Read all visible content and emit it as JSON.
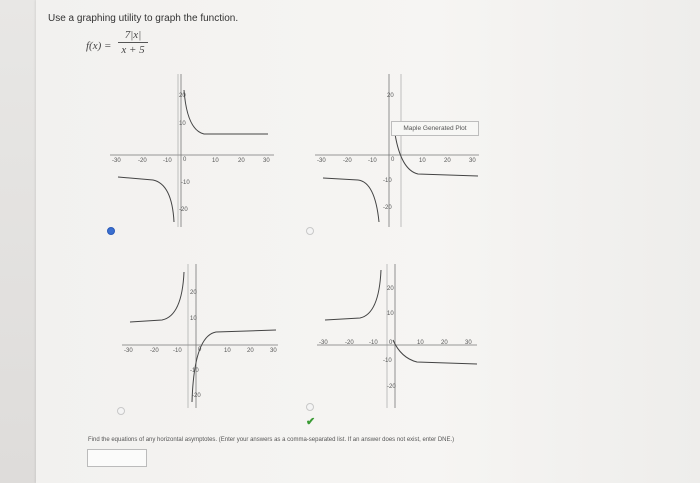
{
  "prompt": "Use a graphing utility to graph the function.",
  "function": {
    "label": "f(x) =",
    "numerator": "7|x|",
    "denominator": "x + 5"
  },
  "options": [
    {
      "id": "A",
      "selected": true,
      "x_ticks": [
        "-30",
        "-20",
        "-10",
        "0",
        "10",
        "20",
        "30"
      ],
      "y_ticks": [
        "20",
        "10",
        "-10",
        "-20"
      ]
    },
    {
      "id": "B",
      "selected": false,
      "x_ticks": [
        "-30",
        "-20",
        "-10",
        "0",
        "10",
        "20",
        "30"
      ],
      "y_ticks": [
        "20",
        "-10",
        "-20"
      ],
      "annotation": "Maple Generated Plot"
    },
    {
      "id": "C",
      "selected": false,
      "x_ticks": [
        "-30",
        "-20",
        "-10",
        "0",
        "10",
        "20",
        "30"
      ],
      "y_ticks": [
        "20",
        "10",
        "-10",
        "-20"
      ]
    },
    {
      "id": "D",
      "selected": false,
      "x_ticks": [
        "-30",
        "-20",
        "-10",
        "0",
        "10",
        "20",
        "30"
      ],
      "y_ticks": [
        "20",
        "10",
        "-10",
        "-20"
      ]
    }
  ],
  "correct_mark": "✔",
  "question": "Find the equations of any horizontal asymptotes. (Enter your answers as a comma-separated list. If an answer does not exist, enter DNE.)",
  "answer_value": "",
  "colors": {
    "curve": "#444444",
    "axis": "#777777",
    "selected_radio": "#3a6fd0",
    "check": "#3a9b35"
  }
}
